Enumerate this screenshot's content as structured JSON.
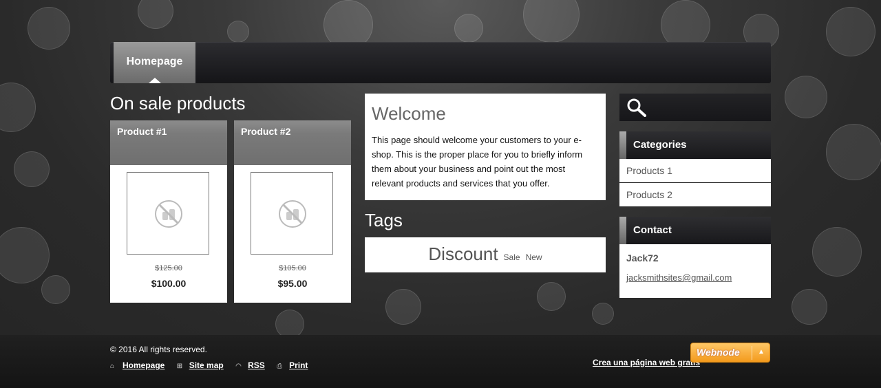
{
  "nav": {
    "tabs": [
      {
        "label": "Homepage"
      }
    ]
  },
  "sale": {
    "heading": "On sale products",
    "products": [
      {
        "name": "Product #1",
        "old_price": "$125.00",
        "price": "$100.00"
      },
      {
        "name": "Product #2",
        "old_price": "$105.00",
        "price": "$95.00"
      }
    ]
  },
  "welcome": {
    "title": "Welcome",
    "body": "This page should welcome your customers to your e-shop. This is the proper place for you to briefly inform them about your business and point out the most relevant products and services that you offer."
  },
  "tags": {
    "heading": "Tags",
    "items": [
      {
        "label": "Discount"
      },
      {
        "label": "Sale"
      },
      {
        "label": "New"
      }
    ]
  },
  "sidebar": {
    "search_icon": "magnifier-icon",
    "categories": {
      "title": "Categories",
      "items": [
        {
          "label": "Products 1"
        },
        {
          "label": "Products 2"
        }
      ]
    },
    "contact": {
      "title": "Contact",
      "name": "Jack72",
      "email": "jacksmithsites@gmail.com"
    }
  },
  "footer": {
    "copyright": "© 2016 All rights reserved.",
    "links": [
      {
        "label": "Homepage",
        "icon": "home-icon"
      },
      {
        "label": "Site map",
        "icon": "sitemap-icon"
      },
      {
        "label": "RSS",
        "icon": "rss-icon"
      },
      {
        "label": "Print",
        "icon": "print-icon"
      }
    ],
    "crea": "Crea una página web gratis",
    "brand": "Webnode"
  },
  "colors": {
    "accent": "#f39a1c",
    "panel": "#ffffff",
    "header": "#1a1a1d"
  }
}
